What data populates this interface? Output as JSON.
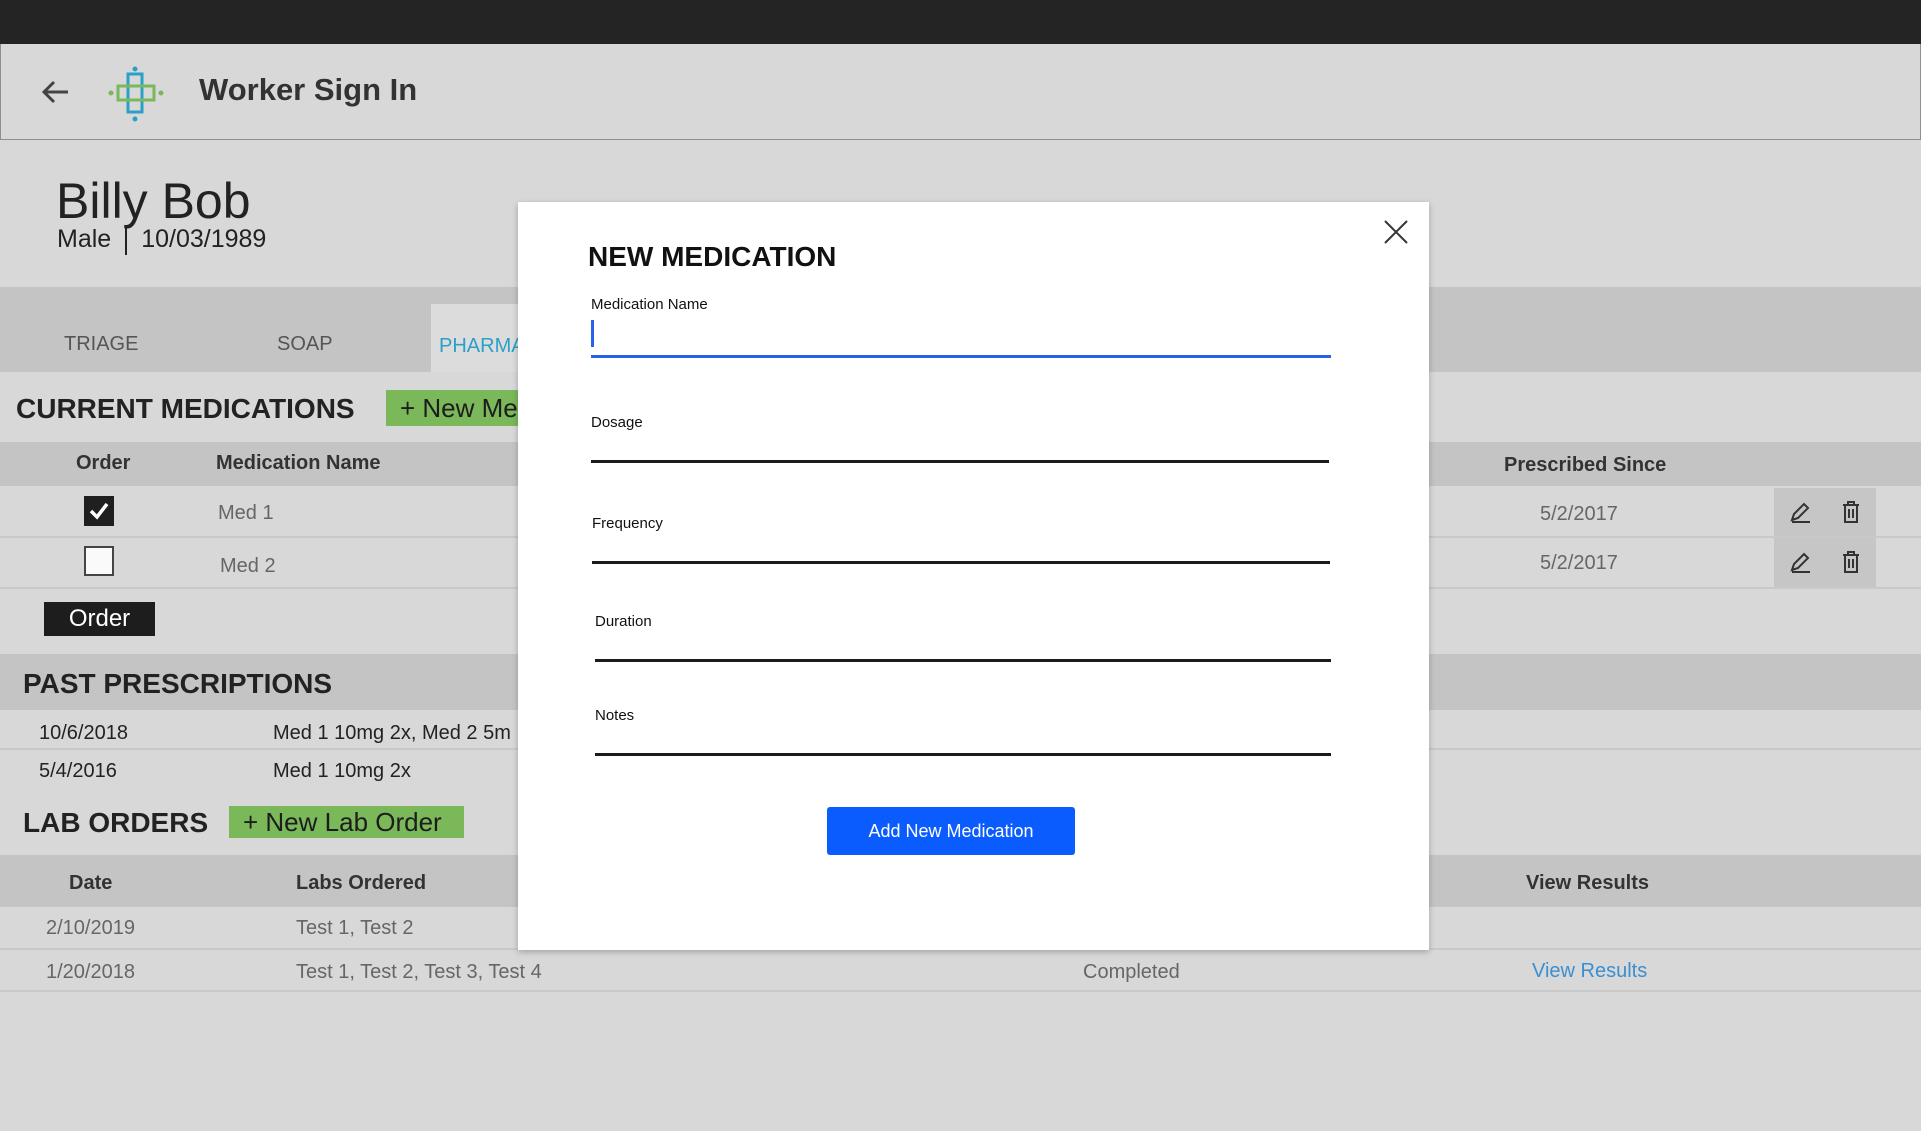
{
  "app": {
    "title": "Worker Sign In"
  },
  "patient": {
    "name": "Billy Bob",
    "sex": "Male",
    "dob": "10/03/1989"
  },
  "tabs": [
    {
      "label": "TRIAGE",
      "active": false
    },
    {
      "label": "SOAP",
      "active": false
    },
    {
      "label": "PHARMA",
      "active": true
    }
  ],
  "current_medications": {
    "title": "CURRENT MEDICATIONS",
    "new_button": "+ New Me",
    "headers": {
      "order": "Order",
      "name": "Medication Name",
      "since": "Prescribed Since"
    },
    "rows": [
      {
        "name": "Med 1",
        "since": "5/2/2017",
        "ordered": true
      },
      {
        "name": "Med 2",
        "since": "5/2/2017",
        "ordered": false
      }
    ],
    "order_button": "Order"
  },
  "past_prescriptions": {
    "title": "PAST PRESCRIPTIONS",
    "rows": [
      {
        "date": "10/6/2018",
        "meds": "Med 1 10mg 2x, Med 2 5m"
      },
      {
        "date": "5/4/2016",
        "meds": "Med 1 10mg 2x"
      }
    ]
  },
  "lab_orders": {
    "title": "LAB ORDERS",
    "new_button": "+ New Lab Order",
    "headers": {
      "date": "Date",
      "labs": "Labs Ordered",
      "results": "View Results"
    },
    "rows": [
      {
        "date": "2/10/2019",
        "labs": "Test 1, Test 2",
        "status": "",
        "results": ""
      },
      {
        "date": "1/20/2018",
        "labs": "Test 1, Test 2, Test 3, Test 4",
        "status": "Completed",
        "results": "View Results"
      }
    ]
  },
  "modal": {
    "title": "NEW MEDICATION",
    "fields": {
      "name": {
        "label": "Medication Name",
        "value": ""
      },
      "dosage": {
        "label": "Dosage",
        "value": ""
      },
      "frequency": {
        "label": "Frequency",
        "value": ""
      },
      "duration": {
        "label": "Duration",
        "value": ""
      },
      "notes": {
        "label": "Notes",
        "value": ""
      }
    },
    "submit": "Add New Medication"
  },
  "colors": {
    "accent_blue": "#0b5cff",
    "focus_blue": "#2862e8",
    "tab_active": "#2aa0c8",
    "green_button": "#7ab85a",
    "link": "#3b8fd0"
  },
  "icons": [
    "back-arrow-icon",
    "medical-cross-logo-icon",
    "checkmark-icon",
    "pencil-icon",
    "trash-icon",
    "close-icon"
  ]
}
